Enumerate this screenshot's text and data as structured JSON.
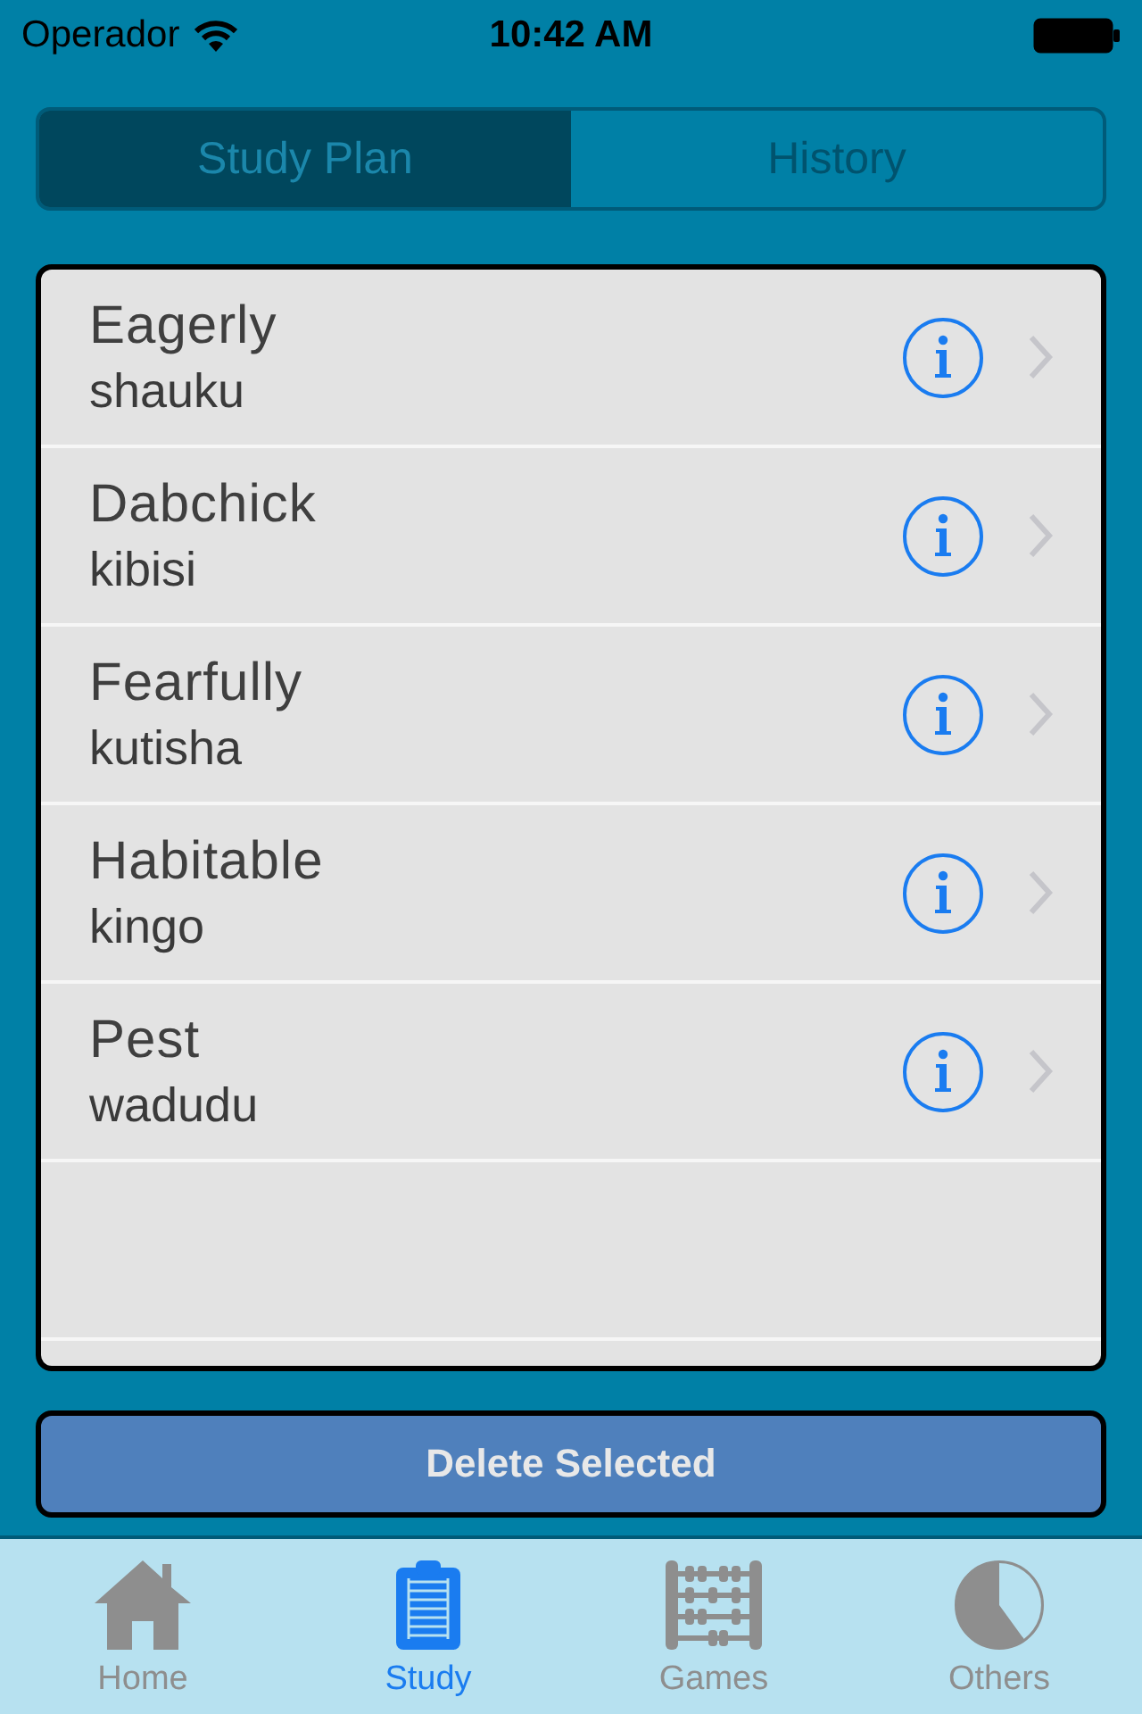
{
  "status_bar": {
    "carrier": "Operador",
    "time": "10:42 AM"
  },
  "segments": [
    {
      "label": "Study Plan",
      "selected": true
    },
    {
      "label": "History",
      "selected": false
    }
  ],
  "words": [
    {
      "word": "Eagerly",
      "translation": "shauku"
    },
    {
      "word": "Dabchick",
      "translation": "kibisi"
    },
    {
      "word": "Fearfully",
      "translation": "kutisha"
    },
    {
      "word": "Habitable",
      "translation": "kingo"
    },
    {
      "word": "Pest",
      "translation": "wadudu"
    }
  ],
  "delete_button": {
    "label": "Delete Selected"
  },
  "tab_bar": [
    {
      "kind": "home",
      "label": "Home",
      "selected": false
    },
    {
      "kind": "study",
      "label": "Study",
      "selected": true
    },
    {
      "kind": "games",
      "label": "Games",
      "selected": false
    },
    {
      "kind": "others",
      "label": "Others",
      "selected": false
    }
  ]
}
